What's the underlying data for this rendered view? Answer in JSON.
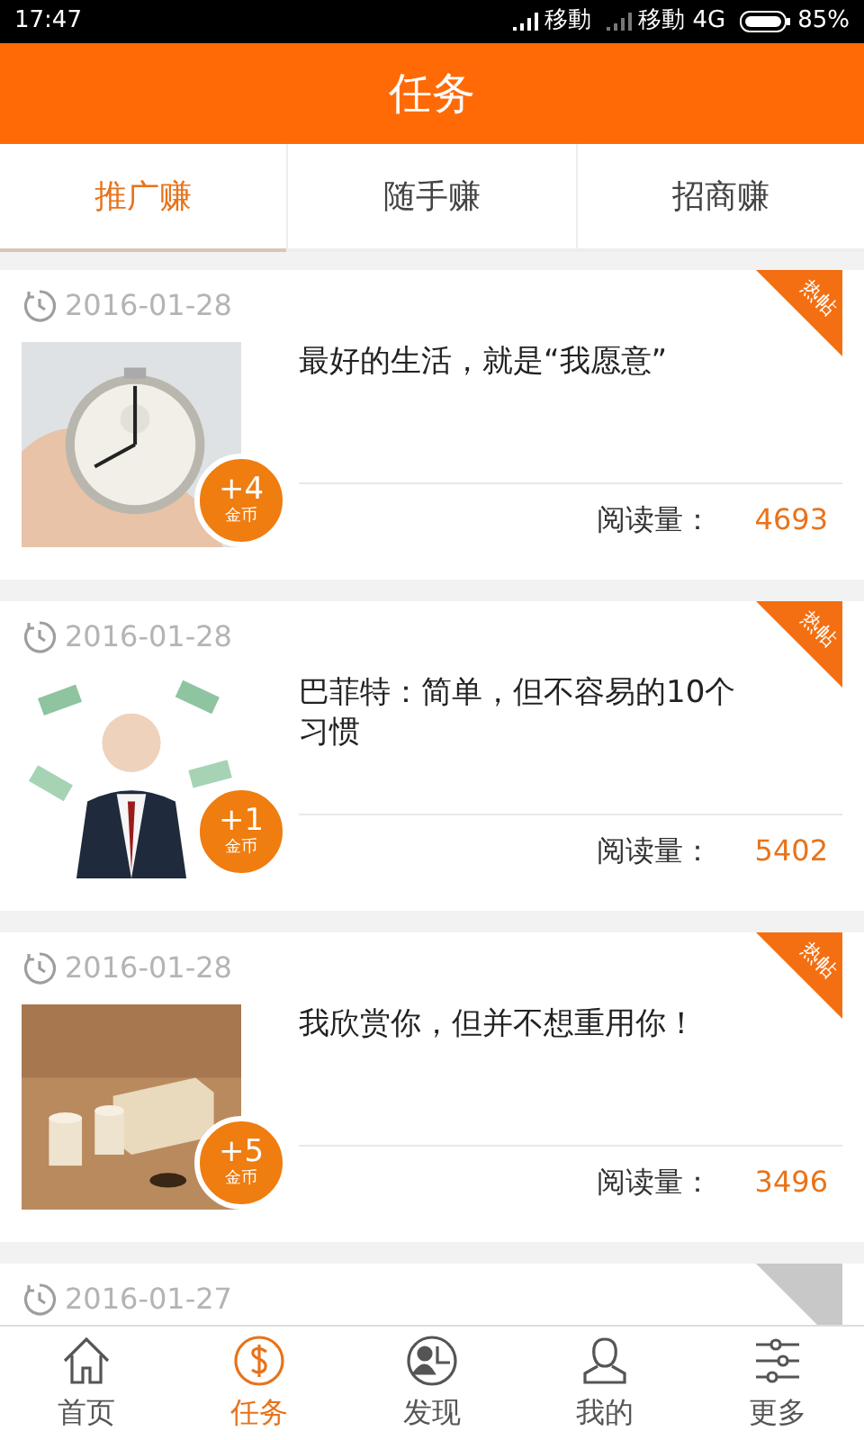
{
  "status_bar": {
    "time": "17:47",
    "carrier_1": "移動",
    "carrier_2": "移動 4G",
    "battery": "85%"
  },
  "header": {
    "title": "任务"
  },
  "tabs": [
    {
      "label": "推广赚",
      "selected": true
    },
    {
      "label": "随手赚",
      "selected": false
    },
    {
      "label": "招商赚",
      "selected": false
    }
  ],
  "articles": [
    {
      "date": "2016-01-28",
      "hot": true,
      "tag": "热帖",
      "title": "最好的生活，就是“我愿意”",
      "coins": "+4",
      "coin_unit": "金币",
      "reads_label": "阅读量：",
      "reads": "4693"
    },
    {
      "date": "2016-01-28",
      "hot": true,
      "tag": "热帖",
      "title": "巴菲特：简单，但不容易的10个习惯",
      "coins": "+1",
      "coin_unit": "金币",
      "reads_label": "阅读量：",
      "reads": "5402"
    },
    {
      "date": "2016-01-28",
      "hot": true,
      "tag": "热帖",
      "title": "我欣赏你，但并不想重用你！",
      "coins": "+5",
      "coin_unit": "金币",
      "reads_label": "阅读量：",
      "reads": "3496"
    },
    {
      "date": "2016-01-27",
      "hot": false
    }
  ],
  "nav": [
    {
      "label": "首页",
      "selected": false
    },
    {
      "label": "任务",
      "selected": true
    },
    {
      "label": "发现",
      "selected": false
    },
    {
      "label": "我的",
      "selected": false
    },
    {
      "label": "更多",
      "selected": false
    }
  ]
}
